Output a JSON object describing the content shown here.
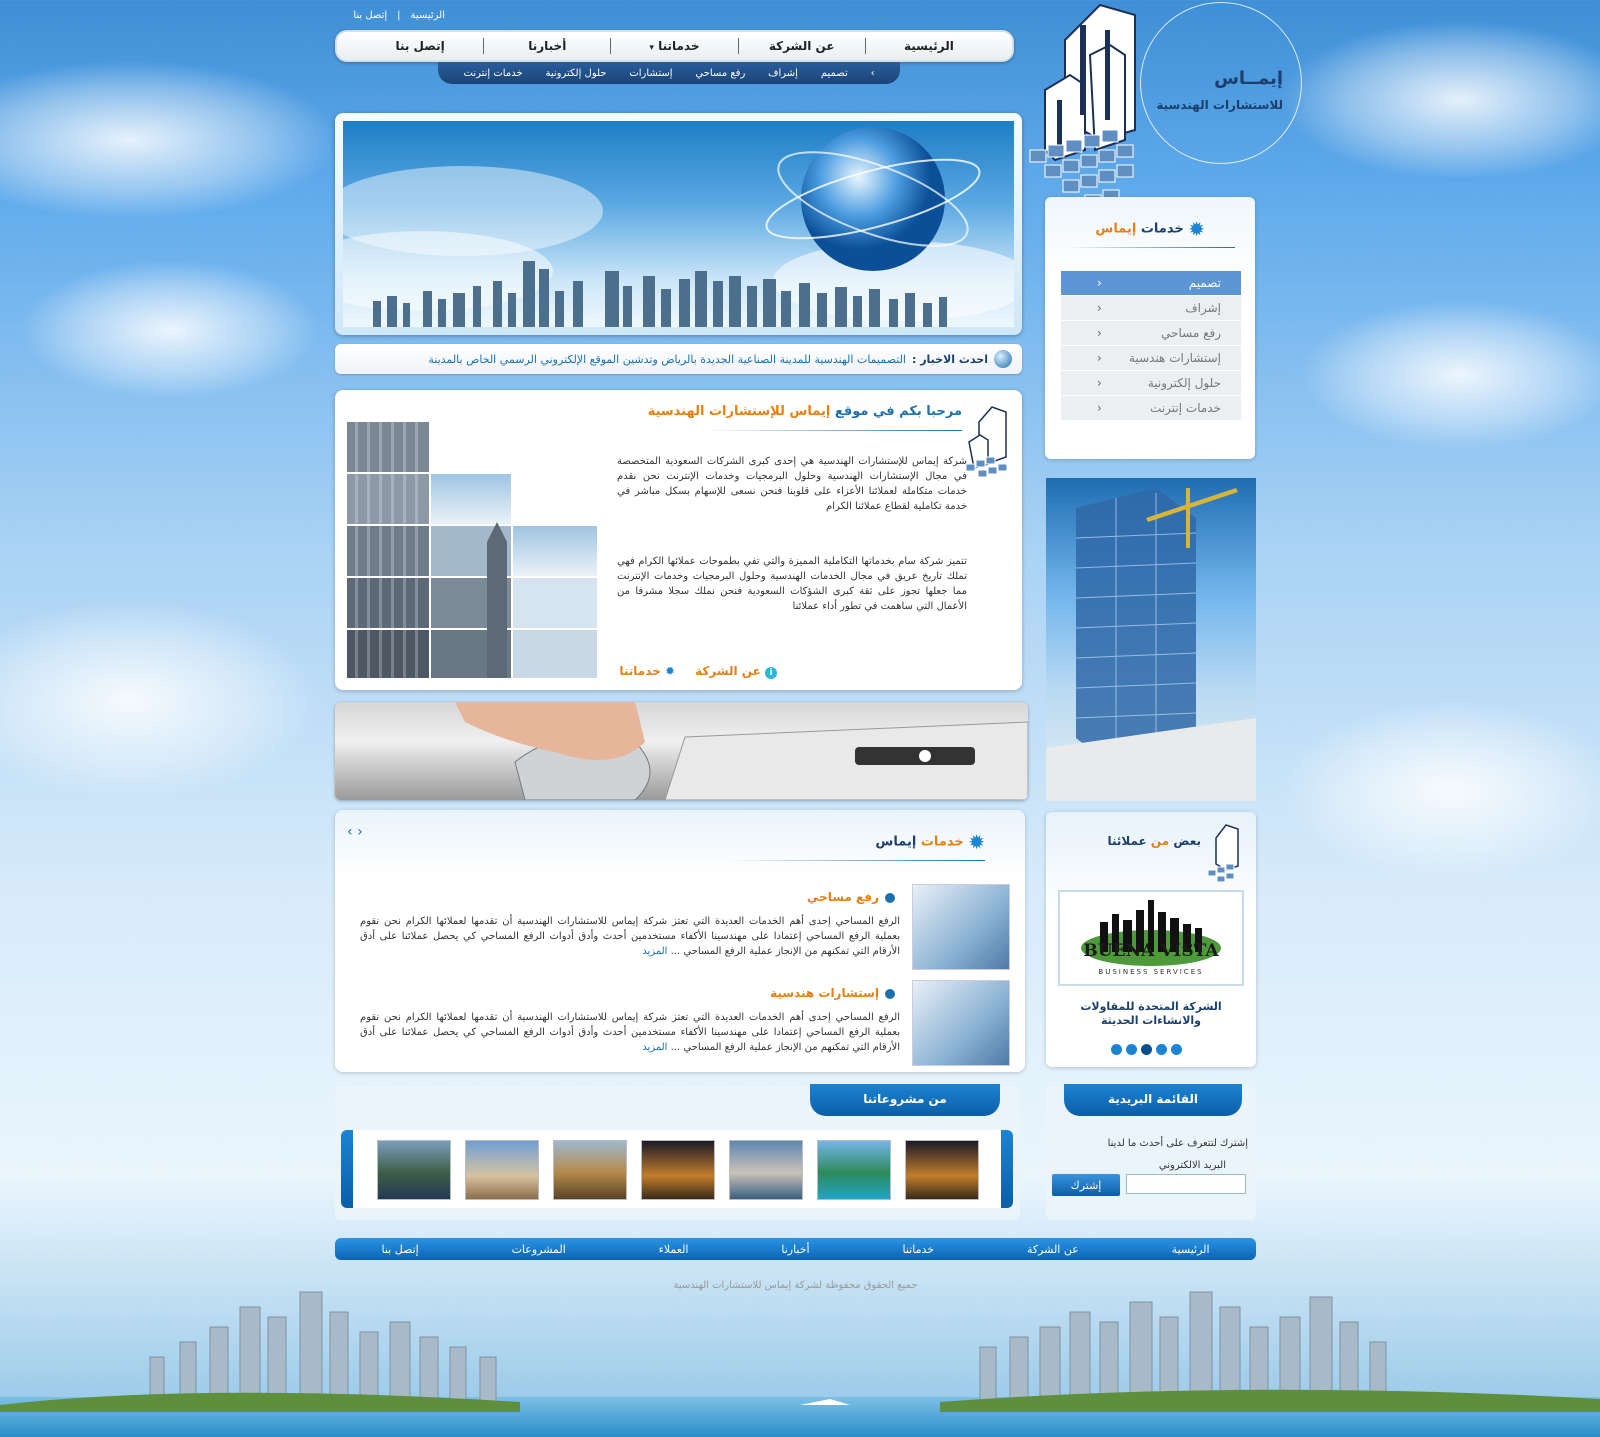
{
  "top_links": [
    "الرئيسية",
    "إتصل بنا"
  ],
  "main_nav": [
    "الرئيسية",
    "عن الشركة",
    "خدماتنا",
    "أخبارنا",
    "إتصل بنا"
  ],
  "sub_nav": [
    "تصميم",
    "إشراف",
    "رفع مساحي",
    "إستشارات",
    "حلول إلكترونية",
    "خدمات إنترنت"
  ],
  "logo": {
    "name": "إيمــاس",
    "tagline": "للاستشارات الهندسية"
  },
  "news": {
    "label": "احدث الاخبار :",
    "text": "التصميمات الهندسية للمدينة الصناعية الجديدة بالرياض وتدشين الموقع الإلكتروني الرسمي الخاص بالمدينة"
  },
  "welcome": {
    "title_prefix": "مرحبا بكم في موقع",
    "title_brand": "إيماس للإستشارات الهندسية",
    "p1": "شركة إيماس للإستشارات الهندسية هي إحدى كبرى الشركات السعودية المتخصصة في مجال الإستشارات الهندسية وحلول البرمجيات وخدمات الإنترنت نحن نقدم خدمات متكاملة لعملائنا الأعزاء على قلوبنا فنحن نسعى للإسهام بسكل مباشر في خدمة تكاملية لقطاع عملائنا الكرام",
    "p2": "تتميز شركة سام بخدماتها التكاملية المميزة والتي تفي بطموحات عملائها الكرام فهي تملك تاريخ عريق في مجال الخدمات الهندسية وحلول البرمجيات وخدمات الإنترنت مما جعلها تجوز على ثقة كبرى الشؤكات السعودية فنحن نملك سجلا مشرفا من الأعمال التي ساهمت في تطور أداء عملائنا",
    "link_about": "عن الشركة",
    "link_services": "خدماتنا"
  },
  "services": {
    "heading_a": "خدمات",
    "heading_b": "إيماس",
    "items": [
      {
        "title": "رفع مساحي",
        "text": "الرفع المساحي إحدى أهم الخدمات العديدة التي تعتز شركة إيماس للاستشارات الهندسية أن تقدمها لعملائها الكرام نحن نقوم بعملية الرفع المساحي إعتمادا على مهندسينا الأكفاء مستخدمين أحدث وأدق أدوات الرفع المساحي كي يحصل عملائنا على أدق الأرقام التي تمكنهم من الإنجاز عملية الرفع المساحي ...",
        "more": "المزيد"
      },
      {
        "title": "إستشارات هندسية",
        "text": "الرفع المساحي إحدى أهم الخدمات العديدة التي تعتز شركة إيماس للاستشارات الهندسية أن تقدمها لعملائها الكرام نحن نقوم بعملية الرفع المساحي إعتمادا على مهندسينا الأكفاء مستخدمين أحدث وأدق أدوات الرفع المساحي كي يحصل عملائنا على أدق الأرقام التي تمكنهم من الإنجاز عملية الرفع المساحي ...",
        "more": "المزيد"
      }
    ]
  },
  "projects": {
    "title": "من مشروعاتنا"
  },
  "sidebar": {
    "heading_a": "خدمات",
    "heading_b": "إيماس",
    "items": [
      "تصميم",
      "إشراف",
      "رفع مساحي",
      "إستشارات هندسية",
      "حلول إلكترونية",
      "خدمات إنترنت"
    ]
  },
  "clients": {
    "heading_a": "بعض",
    "heading_b": "من",
    "heading_c": "عملائنا",
    "logo_text": "BUENA VISTA",
    "logo_sub": "BUSINESS SERVICES",
    "caption": "الشركة المتحدة للمقاولات والانشاءات الحديثة"
  },
  "mailing": {
    "title": "القائمة البريدية",
    "intro": "إشترك لتتعرف على أحدث ما لدينا",
    "email_label": "البريد الالكتروني",
    "button": "إشترك"
  },
  "footer_nav": [
    "الرئيسية",
    "عن الشركة",
    "خدماتنا",
    "أخبارنا",
    "العملاء",
    "المشروعات",
    "إتصل بنا"
  ],
  "copyright": "جميع الحقوق محفوظة لشركة إيماس للاستشارات الهندسية",
  "colors": {
    "brand_blue": "#1d6fb0",
    "accent_orange": "#e87f10",
    "nav_dark": "#1a4477"
  }
}
